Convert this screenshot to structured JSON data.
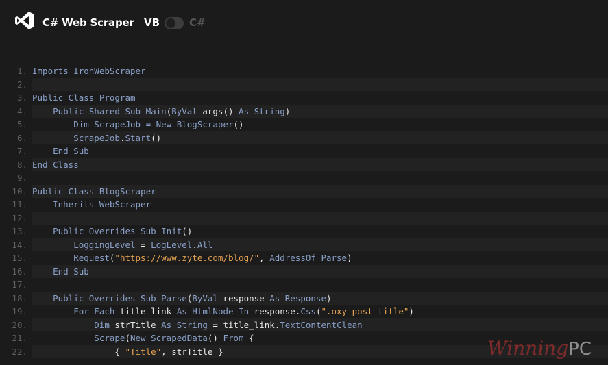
{
  "header": {
    "title": "C# Web Scraper",
    "lang_left": "VB",
    "lang_right": "C#",
    "toggle_state": "VB",
    "logo_icon": "visual-studio-icon"
  },
  "code": {
    "colors": {
      "keyword": "#8aa0c8",
      "type": "#7fa8c8",
      "string": "#e2a052",
      "plain": "#e6e6e6"
    },
    "lines": [
      {
        "n": "1.",
        "tokens": [
          [
            "kw",
            "Imports IronWebScraper"
          ]
        ]
      },
      {
        "n": "2.",
        "tokens": []
      },
      {
        "n": "3.",
        "tokens": [
          [
            "kw",
            "Public Class Program"
          ]
        ]
      },
      {
        "n": "4.",
        "tokens": [
          [
            "kw",
            "    Public Shared Sub Main"
          ],
          [
            "pu",
            "("
          ],
          [
            "kw",
            "ByVal "
          ],
          [
            "pl",
            "args"
          ],
          [
            "pu",
            "() "
          ],
          [
            "kw",
            "As String"
          ],
          [
            "pu",
            ")"
          ]
        ]
      },
      {
        "n": "5.",
        "tokens": [
          [
            "kw",
            "        Dim ScrapeJob = New BlogScraper"
          ],
          [
            "pu",
            "()"
          ]
        ]
      },
      {
        "n": "6.",
        "tokens": [
          [
            "kw",
            "        ScrapeJob"
          ],
          [
            "pu",
            "."
          ],
          [
            "kw",
            "Start"
          ],
          [
            "pu",
            "()"
          ]
        ]
      },
      {
        "n": "7.",
        "tokens": [
          [
            "kw",
            "    End Sub"
          ]
        ]
      },
      {
        "n": "8.",
        "tokens": [
          [
            "kw",
            "End Class"
          ]
        ]
      },
      {
        "n": "9.",
        "tokens": []
      },
      {
        "n": "10.",
        "tokens": [
          [
            "kw",
            "Public Class BlogScraper"
          ]
        ]
      },
      {
        "n": "11.",
        "tokens": [
          [
            "kw",
            "    Inherits WebScraper"
          ]
        ]
      },
      {
        "n": "12.",
        "tokens": []
      },
      {
        "n": "13.",
        "tokens": [
          [
            "kw",
            "    Public Overrides Sub Init"
          ],
          [
            "pu",
            "()"
          ]
        ]
      },
      {
        "n": "14.",
        "tokens": [
          [
            "kw",
            "        LoggingLevel "
          ],
          [
            "pu",
            "= "
          ],
          [
            "kw",
            "LogLevel"
          ],
          [
            "pu",
            "."
          ],
          [
            "kw",
            "All"
          ]
        ]
      },
      {
        "n": "15.",
        "tokens": [
          [
            "kw",
            "        Request"
          ],
          [
            "pu",
            "("
          ],
          [
            "st",
            "\"https://www.zyte.com/blog/\""
          ],
          [
            "pu",
            ", "
          ],
          [
            "kw",
            "AddressOf Parse"
          ],
          [
            "pu",
            ")"
          ]
        ]
      },
      {
        "n": "16.",
        "tokens": [
          [
            "kw",
            "    End Sub"
          ]
        ]
      },
      {
        "n": "17.",
        "tokens": []
      },
      {
        "n": "18.",
        "tokens": [
          [
            "kw",
            "    Public Overrides Sub Parse"
          ],
          [
            "pu",
            "("
          ],
          [
            "kw",
            "ByVal "
          ],
          [
            "pl",
            "response "
          ],
          [
            "kw",
            "As Response"
          ],
          [
            "pu",
            ")"
          ]
        ]
      },
      {
        "n": "19.",
        "tokens": [
          [
            "kw",
            "        For Each "
          ],
          [
            "pl",
            "title_link "
          ],
          [
            "kw",
            "As HtmlNode In "
          ],
          [
            "pl",
            "response"
          ],
          [
            "pu",
            "."
          ],
          [
            "kw",
            "Css"
          ],
          [
            "pu",
            "("
          ],
          [
            "st",
            "\".oxy-post-title\""
          ],
          [
            "pu",
            ")"
          ]
        ]
      },
      {
        "n": "20.",
        "tokens": [
          [
            "kw",
            "            Dim "
          ],
          [
            "pl",
            "strTitle "
          ],
          [
            "kw",
            "As String "
          ],
          [
            "pu",
            "= "
          ],
          [
            "pl",
            "title_link"
          ],
          [
            "pu",
            "."
          ],
          [
            "kw",
            "TextContentClean"
          ]
        ]
      },
      {
        "n": "21.",
        "tokens": [
          [
            "kw",
            "            Scrape"
          ],
          [
            "pu",
            "("
          ],
          [
            "kw",
            "New ScrapedData"
          ],
          [
            "pu",
            "() "
          ],
          [
            "kw",
            "From "
          ],
          [
            "pu",
            "{"
          ]
        ]
      },
      {
        "n": "22.",
        "tokens": [
          [
            "pu",
            "                { "
          ],
          [
            "st",
            "\"Title\""
          ],
          [
            "pu",
            ", "
          ],
          [
            "pl",
            "strTitle "
          ],
          [
            "pu",
            "}"
          ]
        ]
      }
    ]
  },
  "watermark": {
    "text": "Winning",
    "suffix": "PC"
  }
}
